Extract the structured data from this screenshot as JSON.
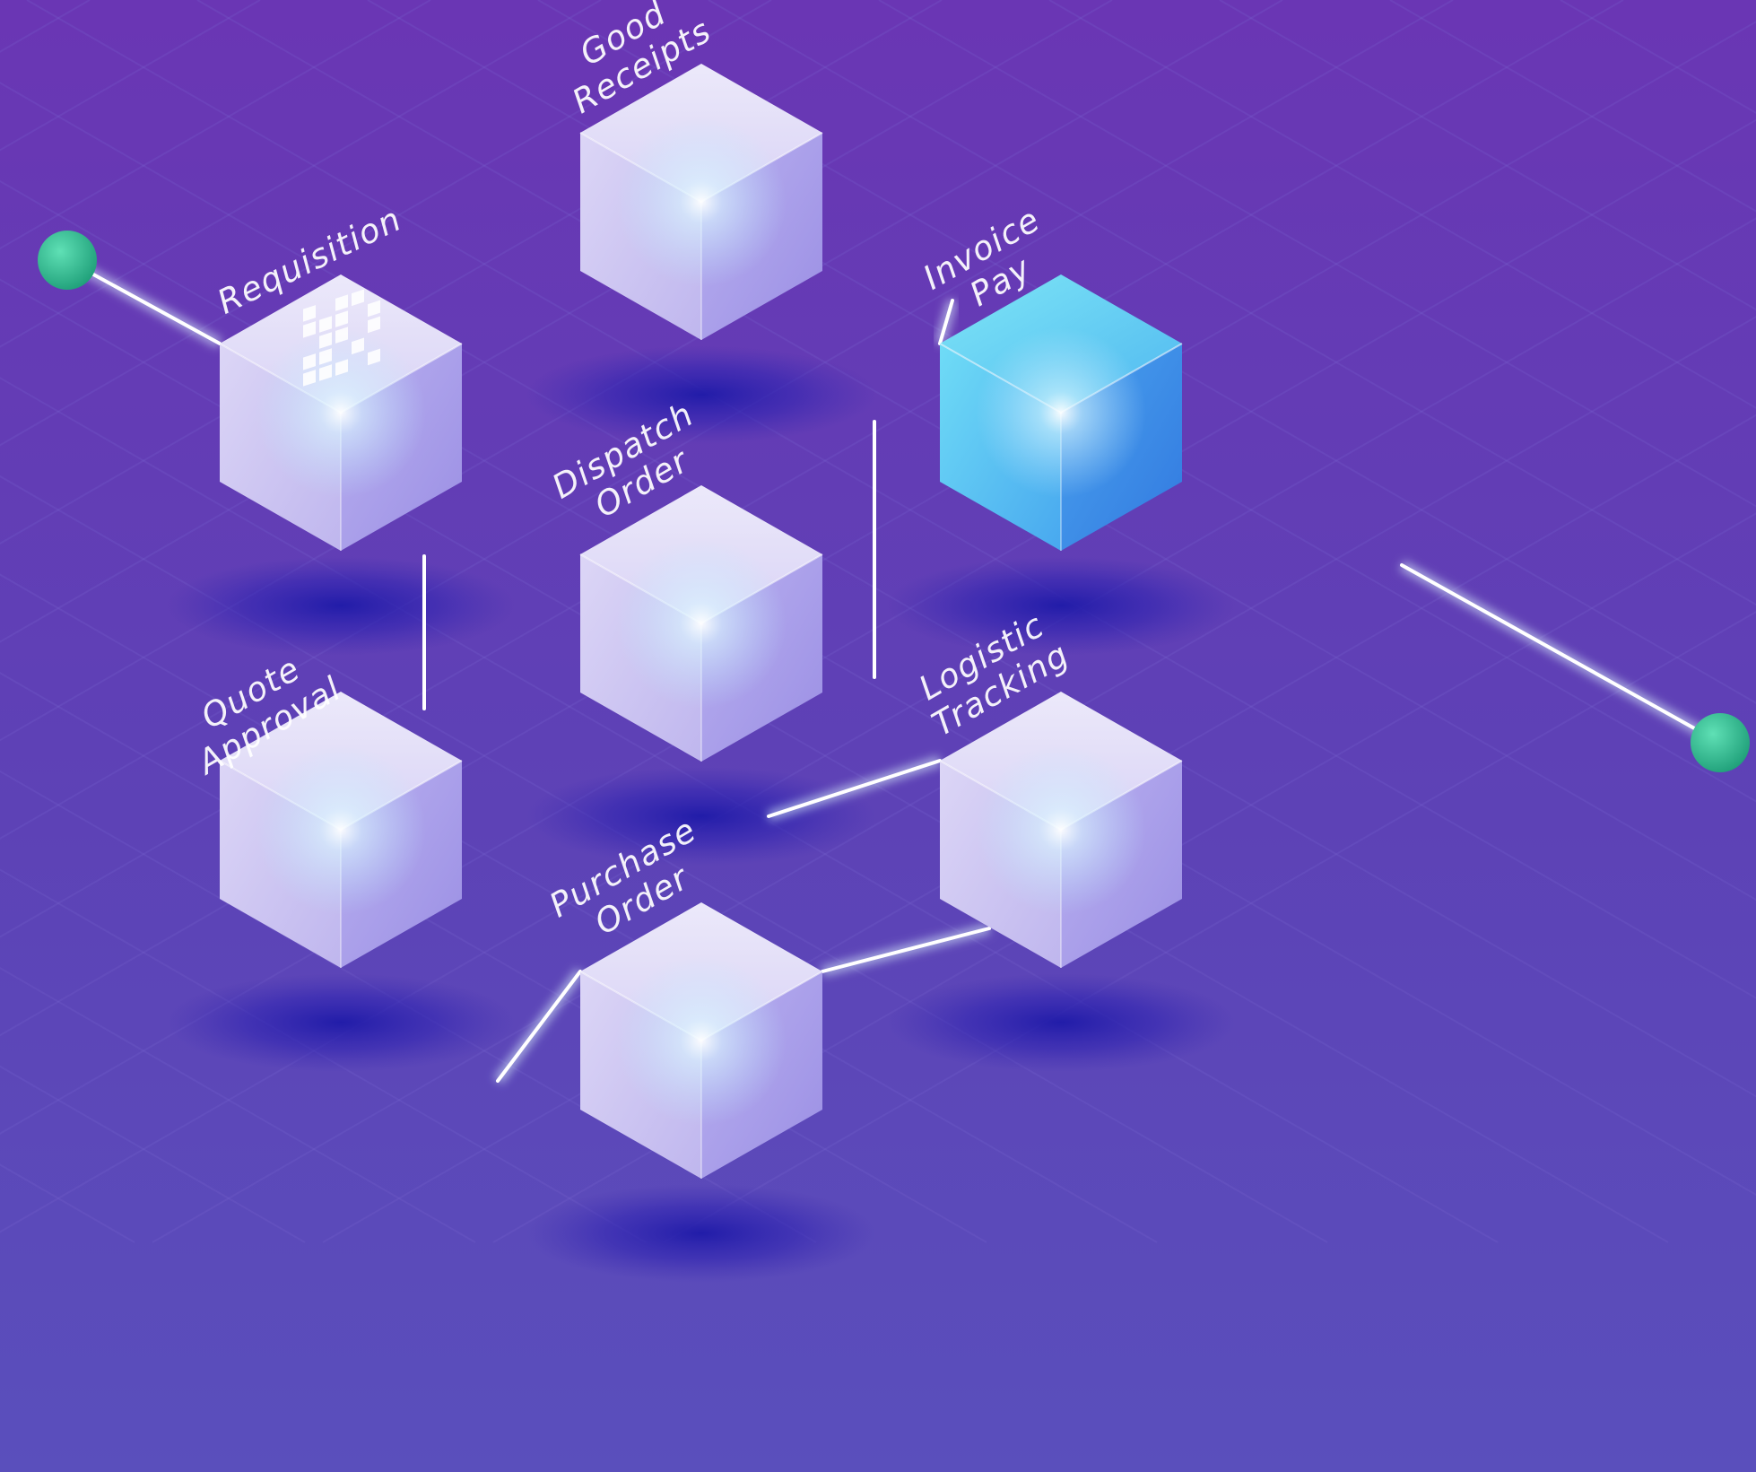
{
  "diagram": {
    "steps": [
      {
        "id": "requisition",
        "lines": [
          "Requisition"
        ]
      },
      {
        "id": "quote-approval",
        "lines": [
          "Quote",
          "Approval"
        ]
      },
      {
        "id": "purchase-order",
        "lines": [
          "Purchase",
          "Order"
        ]
      },
      {
        "id": "logistic-tracking",
        "lines": [
          "Logistic",
          "Tracking"
        ]
      },
      {
        "id": "dispatch-order",
        "lines": [
          "Dispatch",
          "Order"
        ]
      },
      {
        "id": "good-receipts",
        "lines": [
          "Good",
          "Receipts"
        ]
      },
      {
        "id": "invoice-pay",
        "lines": [
          "Invoice",
          "Pay"
        ]
      }
    ],
    "highlight_step": "invoice-pay",
    "colors": {
      "background_top": "#6538b4",
      "background_bottom": "#5a4ab8",
      "cube_top": "#e6e2f8",
      "cube_left": "#cfc8f2",
      "cube_right": "#a99ee8",
      "highlight_top": "#5fd9f2",
      "highlight_left": "#5bc7f3",
      "highlight_right": "#3e8fe6",
      "endpoint": "#2eb98f",
      "connector": "#ffffff"
    }
  }
}
